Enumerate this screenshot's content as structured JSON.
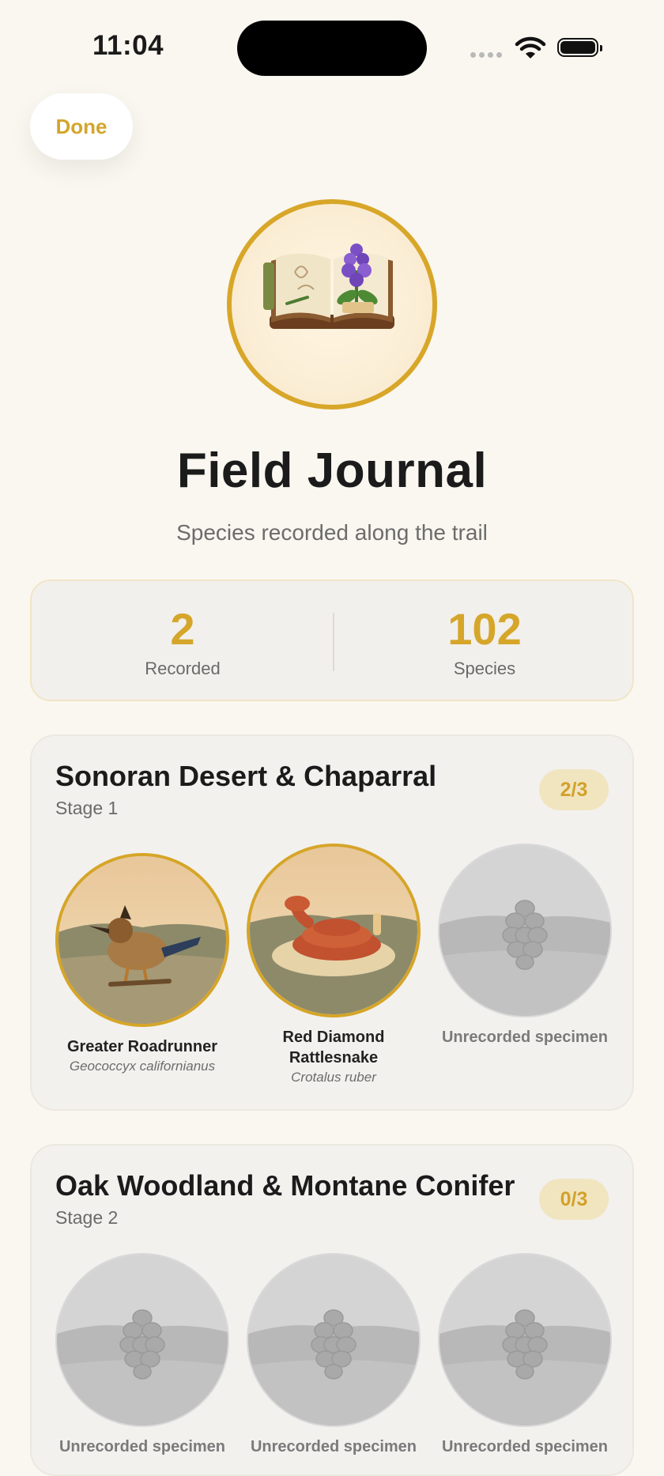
{
  "status": {
    "time": "11:04"
  },
  "toolbar": {
    "done_label": "Done"
  },
  "header": {
    "title": "Field Journal",
    "subtitle": "Species recorded along the trail"
  },
  "stats": [
    {
      "value": "2",
      "label": "Recorded"
    },
    {
      "value": "102",
      "label": "Species"
    }
  ],
  "stages": [
    {
      "title": "Sonoran Desert & Chaparral",
      "stage": "Stage 1",
      "progress": "2/3",
      "specimens": [
        {
          "name": "Greater Roadrunner",
          "scientific": "Geococcyx californianus",
          "recorded": true,
          "icon": "roadrunner-icon"
        },
        {
          "name": "Red Diamond Rattlesnake",
          "scientific": "Crotalus ruber",
          "recorded": true,
          "icon": "rattlesnake-icon"
        },
        {
          "name": "Unrecorded specimen",
          "scientific": "",
          "recorded": false,
          "icon": "pinecone-placeholder-icon"
        }
      ]
    },
    {
      "title": "Oak Woodland & Montane Conifer",
      "stage": "Stage 2",
      "progress": "0/3",
      "specimens": [
        {
          "name": "Unrecorded specimen",
          "scientific": "",
          "recorded": false,
          "icon": "pinecone-placeholder-icon"
        },
        {
          "name": "Unrecorded specimen",
          "scientific": "",
          "recorded": false,
          "icon": "pinecone-placeholder-icon"
        },
        {
          "name": "Unrecorded specimen",
          "scientific": "",
          "recorded": false,
          "icon": "pinecone-placeholder-icon"
        }
      ]
    }
  ],
  "colors": {
    "accent": "#d5a62a",
    "background": "#faf7f0",
    "card": "#f2f1ee"
  }
}
